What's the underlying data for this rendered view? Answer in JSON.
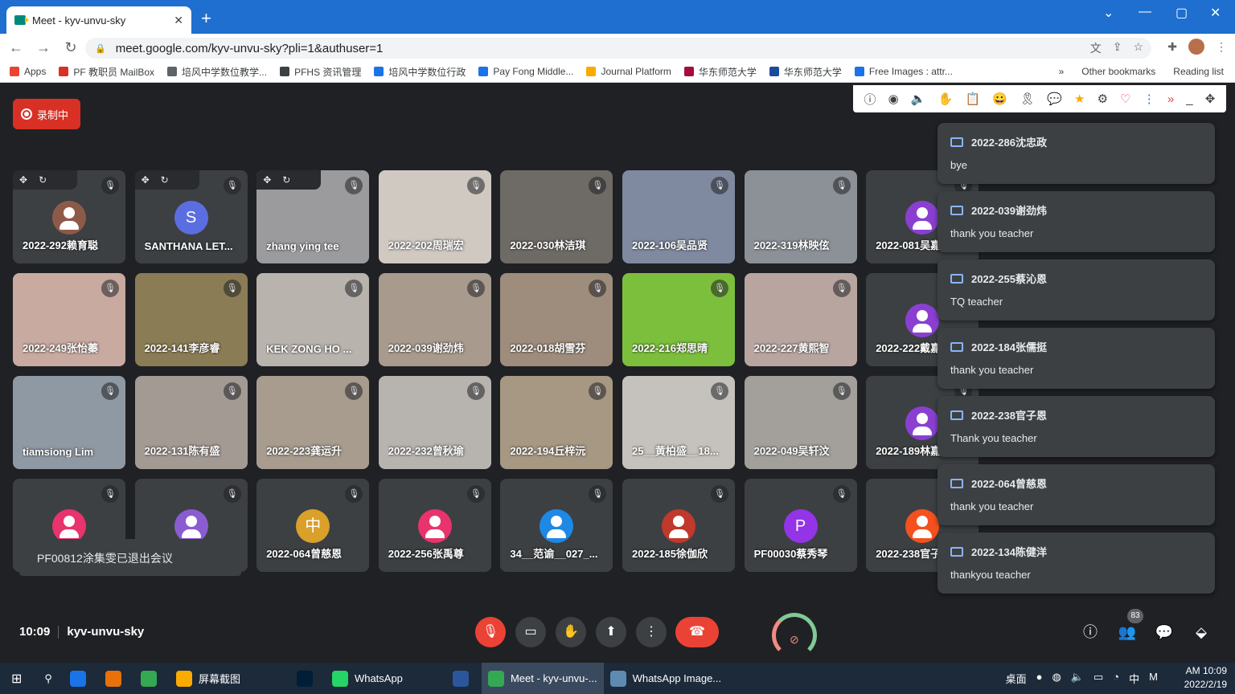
{
  "browser": {
    "tab_title": "Meet - kyv-unvu-sky",
    "url": "meet.google.com/kyv-unvu-sky?pli=1&authuser=1",
    "new_tab": "+",
    "close": "✕",
    "win_min": "—",
    "win_restore": "▢",
    "win_close": "✕",
    "win_chevron": "⌄"
  },
  "bookmarks": {
    "items": [
      {
        "label": "Apps",
        "color": "#ea4335"
      },
      {
        "label": "PF 教职员 MailBox",
        "color": "#d93025"
      },
      {
        "label": "培风中学数位教学...",
        "color": "#5f6368"
      },
      {
        "label": "PFHS 资讯管理",
        "color": "#3c4043"
      },
      {
        "label": "培风中学数位行政",
        "color": "#1a73e8"
      },
      {
        "label": "Pay Fong Middle...",
        "color": "#1a73e8"
      },
      {
        "label": "Journal Platform",
        "color": "#f9ab00"
      },
      {
        "label": "华东师范大学",
        "color": "#a50e3c"
      },
      {
        "label": "华东师范大学",
        "color": "#1a4a9e"
      },
      {
        "label": "Free Images : attr...",
        "color": "#1a73e8"
      }
    ],
    "overflow": "»",
    "other": "Other bookmarks",
    "reading": "Reading list"
  },
  "meet": {
    "recording": "录制中",
    "time": "10:09",
    "code": "kyv-unvu-sky",
    "participants_count": "83",
    "toast": "PF00812涂集雯已退出会议",
    "tiles": [
      {
        "name": "2022-292赖育聪",
        "bg": "#3c4043",
        "avatar": "#8d5a4a",
        "initial": "",
        "ctl": true
      },
      {
        "name": "SANTHANA LET...",
        "bg": "#3c4043",
        "avatar": "#5b6ee1",
        "initial": "S",
        "ctl": true
      },
      {
        "name": "zhang ying tee",
        "bg": "#9b9b9d",
        "avatar": "",
        "initial": "",
        "ctl": true
      },
      {
        "name": "2022-202周瑞宏",
        "bg": "#cfc9c2",
        "avatar": "",
        "initial": ""
      },
      {
        "name": "2022-030林洁琪",
        "bg": "#6e6a66",
        "avatar": "",
        "initial": ""
      },
      {
        "name": "2022-106吴品贤",
        "bg": "#7f8aa0",
        "avatar": "",
        "initial": ""
      },
      {
        "name": "2022-319林映伭",
        "bg": "#8c9198",
        "avatar": "",
        "initial": ""
      },
      {
        "name": "2022-081吴嘉",
        "bg": "#3c4043",
        "avatar": "#8a3fd1",
        "initial": ""
      },
      {
        "name": "2022-249张怡蓁",
        "bg": "#c8aaa0",
        "avatar": "",
        "initial": ""
      },
      {
        "name": "2022-141李彦睿",
        "bg": "#8a7c55",
        "avatar": "",
        "initial": ""
      },
      {
        "name": "KEK ZONG HO ...",
        "bg": "#b9b3ad",
        "avatar": "",
        "initial": ""
      },
      {
        "name": "2022-039谢劲炜",
        "bg": "#a89a8c",
        "avatar": "",
        "initial": ""
      },
      {
        "name": "2022-018胡雪芬",
        "bg": "#9e8d7c",
        "avatar": "",
        "initial": ""
      },
      {
        "name": "2022-216郑思晴",
        "bg": "#7cbf3c",
        "avatar": "",
        "initial": ""
      },
      {
        "name": "2022-227黄熙智",
        "bg": "#b8a5a0",
        "avatar": "",
        "initial": ""
      },
      {
        "name": "2022-222戴嘉",
        "bg": "#3c4043",
        "avatar": "#8a3fd1",
        "initial": ""
      },
      {
        "name": "tiamsiong Lim",
        "bg": "#8f99a4",
        "avatar": "",
        "initial": ""
      },
      {
        "name": "2022-131陈有盛",
        "bg": "#a49a94",
        "avatar": "",
        "initial": ""
      },
      {
        "name": "2022-223龚运升",
        "bg": "#a89c8e",
        "avatar": "",
        "initial": ""
      },
      {
        "name": "2022-232曾秋瑜",
        "bg": "#b7b3ae",
        "avatar": "",
        "initial": ""
      },
      {
        "name": "2022-194丘梓沅",
        "bg": "#a69883",
        "avatar": "",
        "initial": ""
      },
      {
        "name": "25__黄柏盛__18...",
        "bg": "#c5c2bd",
        "avatar": "",
        "initial": ""
      },
      {
        "name": "2022-049吴轩汶",
        "bg": "#a3a09c",
        "avatar": "",
        "initial": ""
      },
      {
        "name": "2022-189林嘉",
        "bg": "#3c4043",
        "avatar": "#8a3fd1",
        "initial": ""
      },
      {
        "name": "",
        "bg": "#3c4043",
        "avatar": "#e8336d",
        "initial": ""
      },
      {
        "name": "",
        "bg": "#3c4043",
        "avatar": "#8a5cd1",
        "initial": ""
      },
      {
        "name": "2022-064曾慈恩",
        "bg": "#3c4043",
        "avatar": "#d9a02a",
        "initial": "中"
      },
      {
        "name": "2022-256张禹尊",
        "bg": "#3c4043",
        "avatar": "#e8336d",
        "initial": ""
      },
      {
        "name": "34__范谕__027_...",
        "bg": "#3c4043",
        "avatar": "#1e88e5",
        "initial": ""
      },
      {
        "name": "2022-185徐伽欣",
        "bg": "#3c4043",
        "avatar": "#c0392b",
        "initial": ""
      },
      {
        "name": "PF00030蔡秀琴",
        "bg": "#3c4043",
        "avatar": "#9334e6",
        "initial": "P"
      },
      {
        "name": "2022-238官子",
        "bg": "#3c4043",
        "avatar": "#f4511e",
        "initial": ""
      }
    ],
    "chats": [
      {
        "who": "2022-286沈忠政",
        "msg": "bye"
      },
      {
        "who": "2022-039谢劲炜",
        "msg": "thank you teacher"
      },
      {
        "who": "2022-255蔡沁恩",
        "msg": "TQ teacher"
      },
      {
        "who": "2022-184张儒挺",
        "msg": "thank you teacher"
      },
      {
        "who": "2022-238官子恩",
        "msg": "Thank you teacher"
      },
      {
        "who": "2022-064曾慈恩",
        "msg": "thank you teacher"
      },
      {
        "who": "2022-134陈健洋",
        "msg": "thankyou teacher"
      }
    ]
  },
  "taskbar": {
    "items": [
      {
        "label": "",
        "color": "#1a73e8"
      },
      {
        "label": "",
        "color": "#e8710a"
      },
      {
        "label": "",
        "color": "#34a853"
      },
      {
        "label": "屏幕截图",
        "color": "#f9ab00"
      },
      {
        "label": "",
        "color": "#001e36"
      },
      {
        "label": "WhatsApp",
        "color": "#25d366"
      },
      {
        "label": "",
        "color": "#2b579a"
      },
      {
        "label": "Meet - kyv-unvu-...",
        "color": "#34a853"
      },
      {
        "label": "WhatsApp Image...",
        "color": "#5f8bb0"
      }
    ],
    "desktop": "桌面",
    "ime": "中",
    "time": "AM 10:09",
    "date": "2022/2/19"
  }
}
